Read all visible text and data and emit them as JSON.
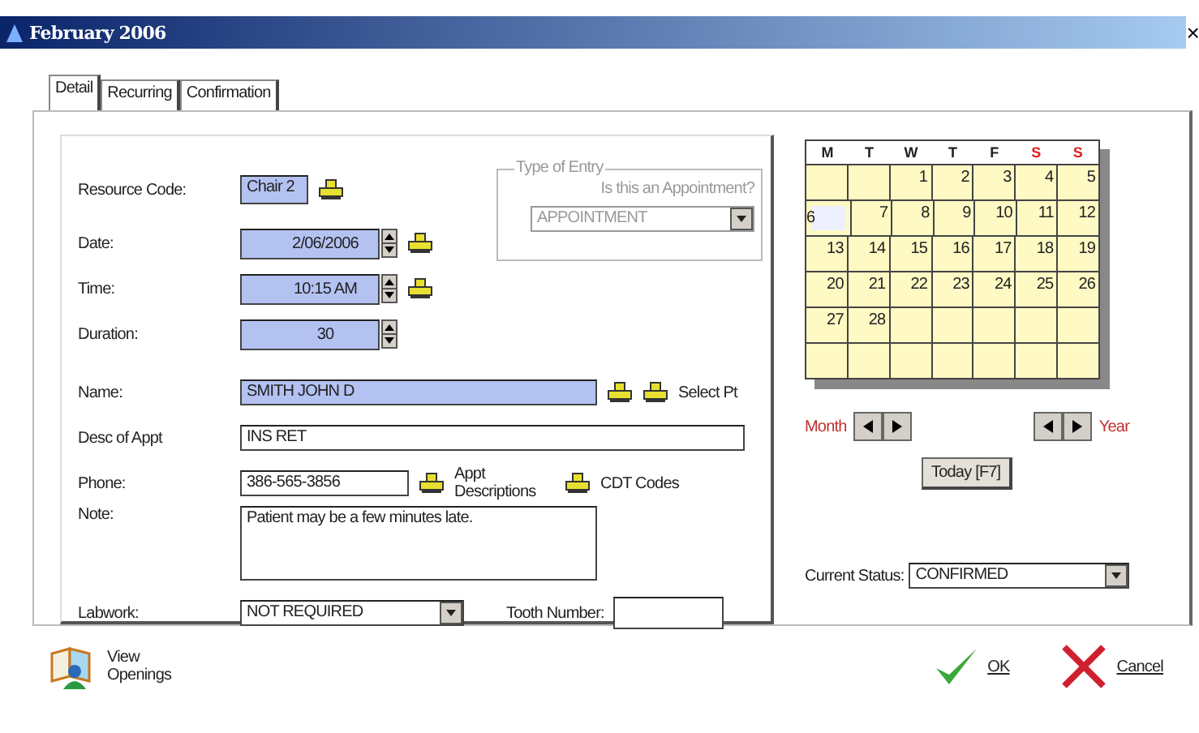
{
  "window": {
    "title": "February 2006",
    "close": "×"
  },
  "tabs": [
    {
      "label": "Detail",
      "selected": true
    },
    {
      "label": "Recurring",
      "selected": false
    },
    {
      "label": "Confirmation",
      "selected": false
    }
  ],
  "form": {
    "rows": [
      {
        "label": "Resource Code:",
        "kind": "text",
        "value": "Chair 2",
        "highlighted": true,
        "lookup": true
      },
      {
        "label": "Date:",
        "kind": "spin",
        "value": "2/06/2006",
        "highlighted": true,
        "lookup": true
      },
      {
        "label": "Time:",
        "kind": "spin",
        "value": "10:15 AM",
        "highlighted": true,
        "lookup": true
      },
      {
        "label": "Duration:",
        "kind": "spin",
        "value": "30",
        "highlighted": true,
        "lookup": false
      },
      {
        "label": "Name:",
        "kind": "text",
        "value": "SMITH JOHN D",
        "highlighted": true,
        "lookup": true,
        "lookups": [
          "Select Pt"
        ]
      },
      {
        "label": "Desc of Appt",
        "kind": "text",
        "value": "INS RET",
        "highlighted": false,
        "lookup": false
      },
      {
        "label": "Phone:",
        "kind": "text",
        "value": "386-565-3856",
        "highlighted": false,
        "lookup": false,
        "lookups": [
          "Appt Descriptions",
          "CDT Codes"
        ]
      },
      {
        "label": "Note:",
        "kind": "textarea",
        "value": "Patient may be a few minutes late.",
        "highlighted": false,
        "lookup": false
      },
      {
        "label": "Labwork:",
        "kind": "select",
        "value": "NOT REQUIRED",
        "highlighted": false,
        "lookup": false,
        "tooth_number": {
          "label": "Tooth Number:"
        }
      }
    ],
    "entry_type": {
      "legend": "Type of Entry",
      "question": "Is this an Appointment?",
      "value": "APPOINTMENT",
      "disabled": true
    }
  },
  "calendar": {
    "weekdays": [
      {
        "label": "M",
        "weekend": false
      },
      {
        "label": "T",
        "weekend": false
      },
      {
        "label": "W",
        "weekend": false
      },
      {
        "label": "T",
        "weekend": false
      },
      {
        "label": "F",
        "weekend": false
      },
      {
        "label": "S",
        "weekend": true
      },
      {
        "label": "S",
        "weekend": true
      }
    ],
    "weeks": [
      [
        {
          "kind": "blank"
        },
        {
          "kind": "blank"
        },
        {
          "day": "1",
          "selected": false
        },
        {
          "day": "2",
          "selected": false
        },
        {
          "day": "3",
          "selected": false
        },
        {
          "day": "4",
          "selected": false
        },
        {
          "day": "5",
          "selected": false
        }
      ],
      [
        {
          "day": "6",
          "selected": true
        },
        {
          "day": "7",
          "selected": false
        },
        {
          "day": "8",
          "selected": false
        },
        {
          "day": "9",
          "selected": false
        },
        {
          "day": "10",
          "selected": false
        },
        {
          "day": "11",
          "selected": false
        },
        {
          "day": "12",
          "selected": false
        }
      ],
      [
        {
          "day": "13",
          "selected": false
        },
        {
          "day": "14",
          "selected": false
        },
        {
          "day": "15",
          "selected": false
        },
        {
          "day": "16",
          "selected": false
        },
        {
          "day": "17",
          "selected": false
        },
        {
          "day": "18",
          "selected": false
        },
        {
          "day": "19",
          "selected": false
        }
      ],
      [
        {
          "day": "20",
          "selected": false
        },
        {
          "day": "21",
          "selected": false
        },
        {
          "day": "22",
          "selected": false
        },
        {
          "day": "23",
          "selected": false
        },
        {
          "day": "24",
          "selected": false
        },
        {
          "day": "25",
          "selected": false
        },
        {
          "day": "26",
          "selected": false
        }
      ],
      [
        {
          "day": "27",
          "selected": false
        },
        {
          "day": "28",
          "selected": false
        },
        {
          "kind": "blank"
        },
        {
          "kind": "blank"
        },
        {
          "kind": "blank"
        },
        {
          "kind": "blank"
        },
        {
          "kind": "blank"
        }
      ],
      [
        {
          "kind": "blank"
        },
        {
          "kind": "blank"
        },
        {
          "kind": "blank"
        },
        {
          "kind": "blank"
        },
        {
          "kind": "blank"
        },
        {
          "kind": "blank"
        },
        {
          "kind": "blank"
        }
      ]
    ],
    "month_label": "Month",
    "year_label": "Year",
    "today_button": "Today [F7]"
  },
  "status": {
    "label": "Current Status:",
    "value": "CONFIRMED"
  },
  "footer": {
    "view_openings": "View Openings",
    "ok": "OK",
    "cancel": "Cancel"
  }
}
